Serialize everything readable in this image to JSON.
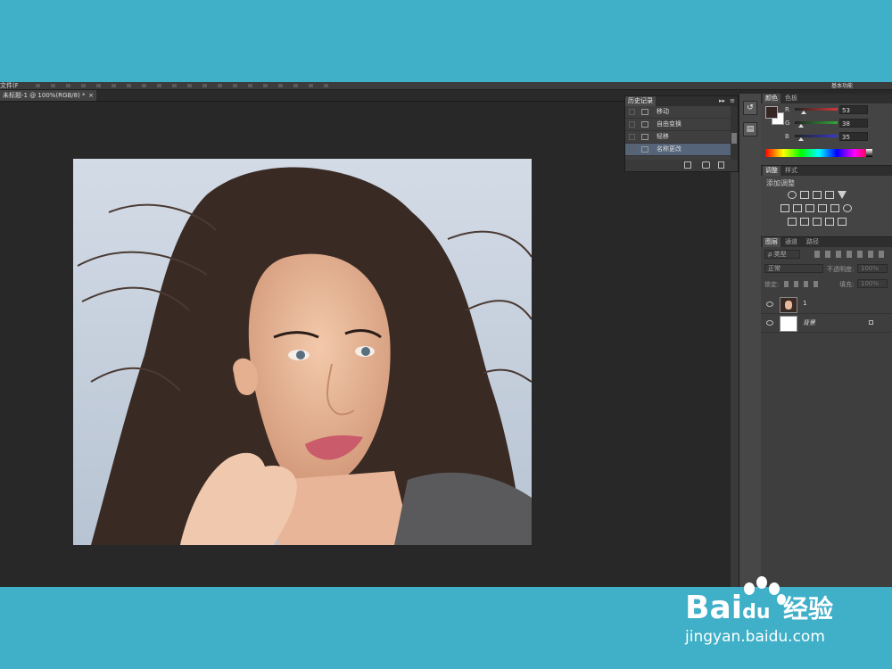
{
  "app": {
    "menu_fragment": "文件(F)",
    "workspace": "基本功能"
  },
  "document_tab": {
    "title": "未标题-1 @ 100%(RGB/8) *",
    "close": "×"
  },
  "history_panel": {
    "tab": "历史记录",
    "items": [
      {
        "label": "移动"
      },
      {
        "label": "自由变换"
      },
      {
        "label": "轻移"
      },
      {
        "label": "名称更改"
      }
    ],
    "selected_index": 3
  },
  "color_panel": {
    "tabs": [
      "颜色",
      "色板"
    ],
    "channels": [
      {
        "name": "R",
        "value": "53",
        "color": "#d23a3a",
        "position": 0.21
      },
      {
        "name": "G",
        "value": "38",
        "color": "#33a839",
        "position": 0.15
      },
      {
        "name": "B",
        "value": "35",
        "color": "#3838d0",
        "position": 0.14
      }
    ],
    "foreground": "#352623",
    "background": "#ffffff"
  },
  "adjustments_panel": {
    "tabs": [
      "调整",
      "样式"
    ],
    "heading": "添加调整"
  },
  "layers_panel": {
    "tabs": [
      "图层",
      "通道",
      "路径"
    ],
    "kind_label": "ρ 类型",
    "blend_mode": "正常",
    "opacity_label": "不透明度:",
    "opacity_value": "100%",
    "lock_label": "锁定:",
    "fill_label": "填充:",
    "fill_value": "100%",
    "layers": [
      {
        "name": "1"
      },
      {
        "name": "背景"
      }
    ]
  },
  "watermark": {
    "brand": "Bai",
    "brand_suffix": "du",
    "product": "经验",
    "url": "jingyan.baidu.com"
  },
  "colors": {
    "frame_band": "#3fb0c8",
    "workspace_bg": "#282828",
    "panel_bg": "#444444",
    "selected_row": "#556479"
  }
}
